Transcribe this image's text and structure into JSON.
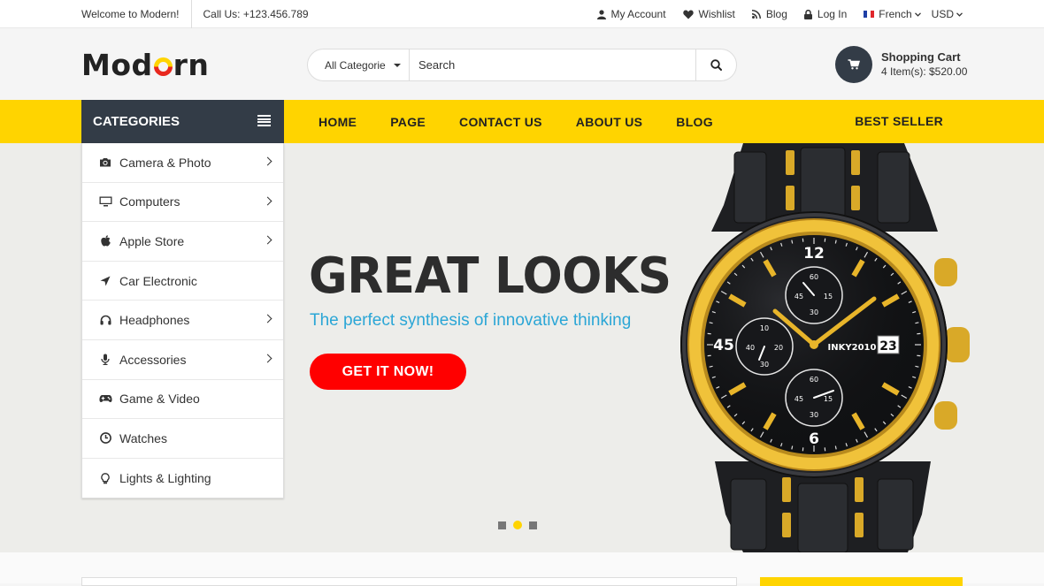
{
  "topbar": {
    "welcome": "Welcome to Modern!",
    "call": "Call Us: +123.456.789",
    "my_account": "My Account",
    "wishlist": "Wishlist",
    "blog": "Blog",
    "login": "Log In",
    "language": "French",
    "currency": "USD"
  },
  "header": {
    "logo_pre": "Mod",
    "logo_post": "rn",
    "search_category": "All Categorie",
    "search_placeholder": "Search",
    "cart_title": "Shopping Cart",
    "cart_summary": "4 Item(s): $520.00"
  },
  "nav": {
    "categories_label": "CATEGORIES",
    "menu": [
      "HOME",
      "PAGE",
      "CONTACT US",
      "ABOUT US",
      "BLOG"
    ],
    "best_seller": "BEST SELLER"
  },
  "sidebar": {
    "items": [
      {
        "label": "Camera & Photo",
        "icon": "camera-icon",
        "has_submenu": true
      },
      {
        "label": "Computers",
        "icon": "monitor-icon",
        "has_submenu": true
      },
      {
        "label": "Apple Store",
        "icon": "apple-icon",
        "has_submenu": true
      },
      {
        "label": "Car Electronic",
        "icon": "location-arrow-icon",
        "has_submenu": false
      },
      {
        "label": "Headphones",
        "icon": "headphones-icon",
        "has_submenu": true
      },
      {
        "label": "Accessories",
        "icon": "microphone-icon",
        "has_submenu": true
      },
      {
        "label": "Game & Video",
        "icon": "gamepad-icon",
        "has_submenu": false
      },
      {
        "label": "Watches",
        "icon": "clock-icon",
        "has_submenu": false
      },
      {
        "label": "Lights & Lighting",
        "icon": "lightbulb-icon",
        "has_submenu": false
      }
    ]
  },
  "hero": {
    "headline": "GREAT LOOKS",
    "tagline": "The perfect synthesis of innovative thinking",
    "cta": "GET IT NOW!",
    "watch_brand": "INKY2010",
    "watch_date": "23",
    "slide_count": 3,
    "active_slide": 2
  },
  "colors": {
    "accent_yellow": "#ffd400",
    "dark_slate": "#333c47",
    "cta_red": "#ff0000",
    "tagline_blue": "#2ba6d6"
  }
}
